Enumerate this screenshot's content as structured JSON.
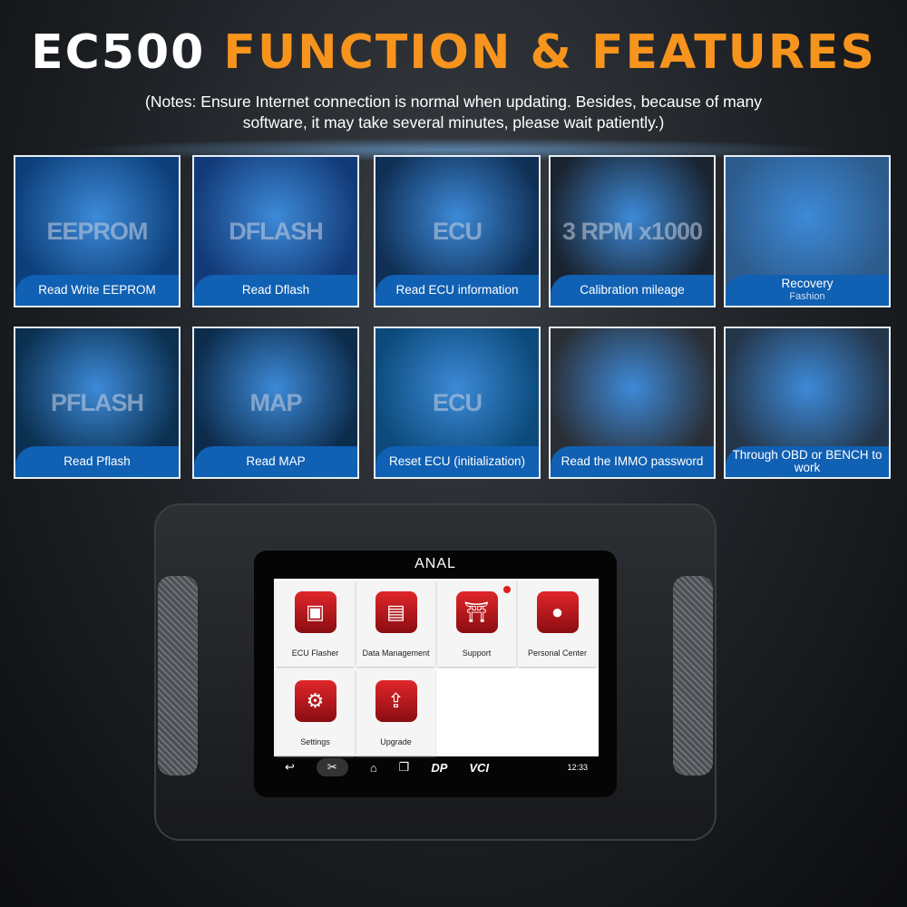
{
  "header": {
    "title_white": "EC500",
    "title_orange": "FUNCTION & FEATURES",
    "notes": "(Notes: Ensure Internet connection is normal when updating. Besides, because of many software, it may take several minutes, please wait patiently.)"
  },
  "features": [
    {
      "overlay": "EEPROM",
      "caption": "Read Write EEPROM"
    },
    {
      "overlay": "DFLASH",
      "caption": "Read Dflash"
    },
    {
      "overlay": "ECU",
      "caption": "Read ECU information"
    },
    {
      "overlay": "3 RPM x1000",
      "caption": "Calibration mileage"
    },
    {
      "overlay": "",
      "caption": "Recovery",
      "sub": "Fashion"
    },
    {
      "overlay": "PFLASH",
      "caption": "Read Pflash"
    },
    {
      "overlay": "MAP",
      "caption": "Read MAP"
    },
    {
      "overlay": "ECU",
      "caption": "Reset ECU (initialization)"
    },
    {
      "overlay": "",
      "caption": "Read the IMMO password"
    },
    {
      "overlay": "",
      "caption": "Through OBD or BENCH to work"
    }
  ],
  "device": {
    "brand": "ANAL",
    "apps": [
      {
        "label": "ECU Flasher",
        "icon": "ecu-flasher-icon",
        "glyph": "▣"
      },
      {
        "label": "Data Management",
        "icon": "data-management-icon",
        "glyph": "▤"
      },
      {
        "label": "Support",
        "icon": "support-icon",
        "glyph": "⛩",
        "badge": true
      },
      {
        "label": "Personal Center",
        "icon": "person-icon",
        "glyph": "●"
      },
      {
        "label": "Settings",
        "icon": "gear-icon",
        "glyph": "⚙"
      },
      {
        "label": "Upgrade",
        "icon": "upload-icon",
        "glyph": "⇪"
      }
    ],
    "nav": {
      "back": "↩",
      "cut": "✂",
      "home": "⌂",
      "recent": "❐",
      "dp": "DP",
      "vci": "VCI",
      "time": "12:33"
    }
  },
  "colors": {
    "accent": "#f7941d",
    "caption_blue": "#1060b3",
    "app_red": "#c8161c"
  }
}
